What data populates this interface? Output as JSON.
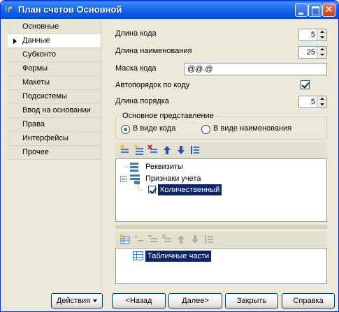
{
  "window": {
    "title": "План счетов Основной",
    "icon": "tree-structure-icon"
  },
  "tabs": [
    {
      "label": "Основные",
      "active": false
    },
    {
      "label": "Данные",
      "active": true
    },
    {
      "label": "Субконто",
      "active": false
    },
    {
      "label": "Формы",
      "active": false
    },
    {
      "label": "Макеты",
      "active": false
    },
    {
      "label": "Подсистемы",
      "active": false
    },
    {
      "label": "Ввод на основании",
      "active": false
    },
    {
      "label": "Права",
      "active": false
    },
    {
      "label": "Интерфейсы",
      "active": false
    },
    {
      "label": "Прочее",
      "active": false
    }
  ],
  "fields": {
    "code_length": {
      "label": "Длина кода",
      "value": "5"
    },
    "name_length": {
      "label": "Длина наименования",
      "value": "25"
    },
    "code_mask": {
      "label": "Маска кода",
      "value": "@@.@"
    },
    "auto_order": {
      "label": "Автопорядок по коду",
      "checked": true
    },
    "order_length": {
      "label": "Длина порядка",
      "value": "5"
    }
  },
  "representation": {
    "title": "Основное представление",
    "options": [
      {
        "label": "В виде кода",
        "selected": true
      },
      {
        "label": "В виде наименования",
        "selected": false
      }
    ]
  },
  "top_toolbar": {
    "icons": [
      "add-item-icon",
      "add-group-icon",
      "delete-icon",
      "move-up-icon",
      "move-down-icon",
      "sort-icon"
    ]
  },
  "top_tree": {
    "nodes": [
      {
        "label": "Реквизиты"
      },
      {
        "label": "Признаки учета"
      },
      {
        "label": "Количественный",
        "selected": true
      }
    ]
  },
  "bottom_toolbar": {
    "icons": [
      "add-table-icon",
      "add-attribute-icon",
      "edit-icon",
      "delete-icon",
      "move-up-icon",
      "move-down-icon",
      "sort-icon"
    ]
  },
  "bottom_tree": {
    "nodes": [
      {
        "label": "Табличные части",
        "selected": true
      }
    ]
  },
  "buttons": {
    "actions": "Действия",
    "back": "<Назад",
    "next": "Далее>",
    "close": "Закрыть",
    "help": "Справка"
  },
  "colors": {
    "titlebar": "#0054e3",
    "selection": "#0a246a",
    "window_bg": "#ece9d8"
  }
}
